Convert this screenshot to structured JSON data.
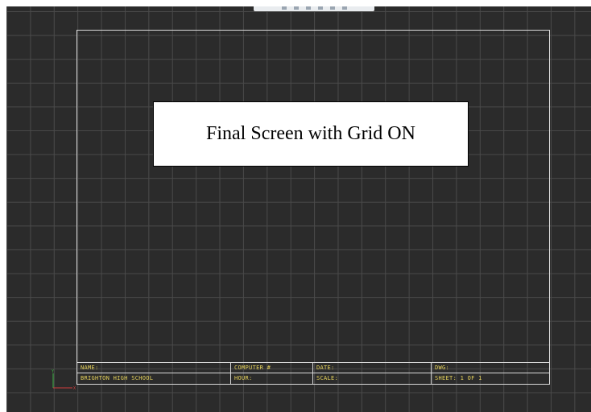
{
  "canvas": {
    "grid": "on",
    "background": "#2b2b2b",
    "grid_color": "#4a4a4a",
    "border_color": "#d9d9d9",
    "title_text_color": "#e8d45c"
  },
  "callout": {
    "text": "Final Screen with Grid ON"
  },
  "title_block": {
    "rows": [
      [
        "NAME:",
        "COMPUTER #",
        "DATE:",
        "DWG:"
      ],
      [
        "BRIGHTON HIGH SCHOOL",
        "HOUR:",
        "SCALE:",
        "SHEET: 1 OF 1"
      ]
    ]
  },
  "axes": {
    "y_label": "Y",
    "x_label": "X",
    "y_color": "#3cb043",
    "x_color": "#d23c3c"
  }
}
